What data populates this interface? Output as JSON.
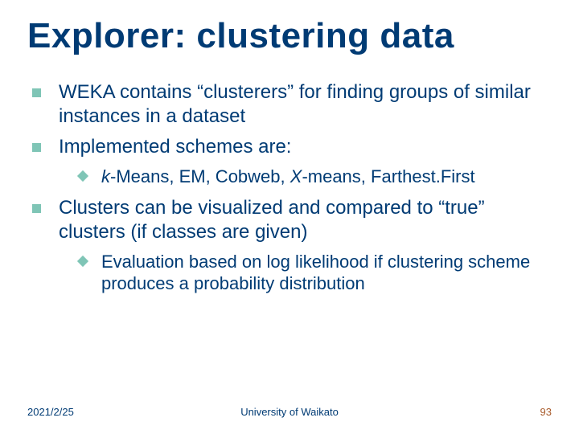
{
  "title": "Explorer: clustering data",
  "bullets": {
    "b1": "WEKA contains “clusterers” for finding groups of similar instances in a dataset",
    "b2": "Implemented schemes are:",
    "b2_sub_prefix": "k",
    "b2_sub_rest": "-Means, EM, Cobweb, ",
    "b2_sub_italic2": "X",
    "b2_sub_tail": "-means, Farthest.First",
    "b3": "Clusters can be visualized and compared to “true” clusters (if classes are given)",
    "b3_sub": "Evaluation based on log likelihood if clustering scheme produces a probability distribution"
  },
  "footer": {
    "date": "2021/2/25",
    "org": "University of Waikato",
    "page": "93"
  }
}
